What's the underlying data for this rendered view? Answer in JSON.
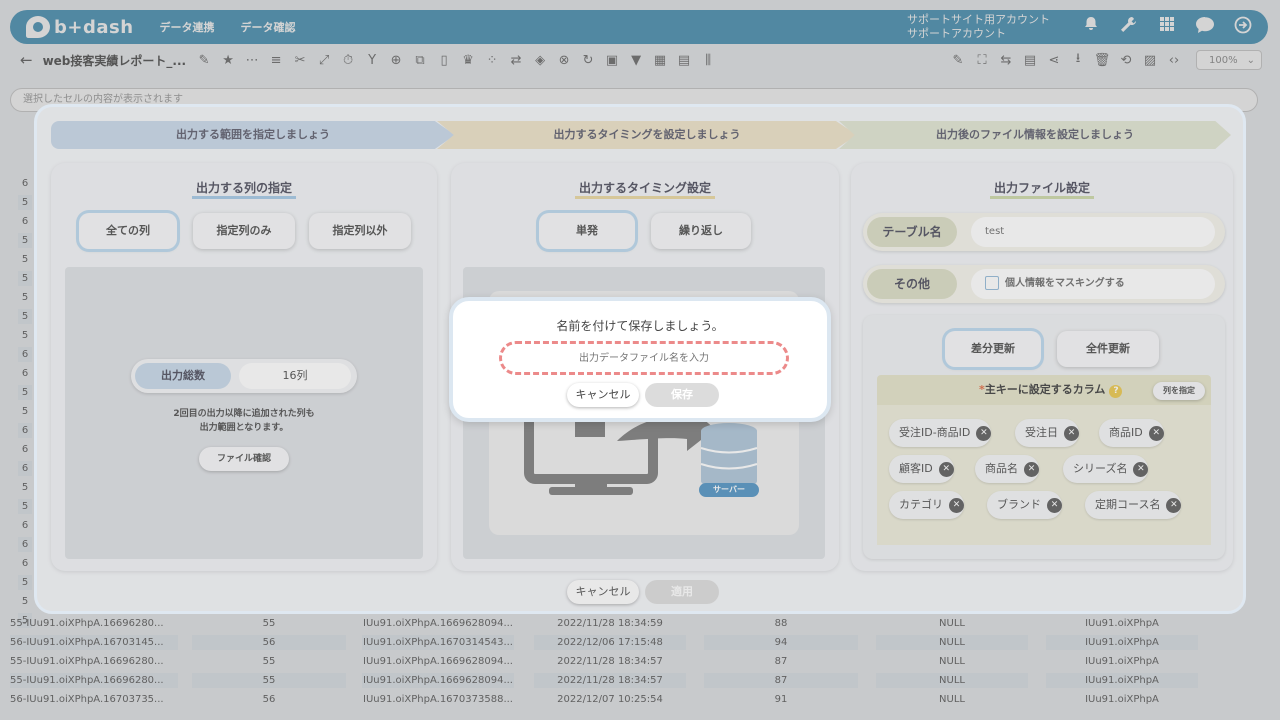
{
  "header": {
    "logo_text": "b+dash",
    "nav": [
      "データ連携",
      "データ確認"
    ],
    "account_line1": "サポートサイト用アカウント",
    "account_line2": "サポートアカウント"
  },
  "toolbar": {
    "back_icon": "arrow-left-icon",
    "report_title": "web接客実績レポート_...",
    "zoom": "100%"
  },
  "cell_bar": {
    "placeholder": "選択したセルの内容が表示されます"
  },
  "bg_table": {
    "top_rows": [
      "6",
      "5",
      "6",
      "5",
      "5",
      "5",
      "5",
      "5",
      "5",
      "6",
      "6",
      "5",
      "5",
      "6",
      "6",
      "6",
      "5",
      "5",
      "6",
      "6",
      "6",
      "5",
      "5",
      "5"
    ],
    "rows": [
      [
        "55-IUu91.oiXPhpA.16696280...",
        "55",
        "IUu91.oiXPhpA.1669628094...",
        "2022/11/28 18:34:59",
        "88",
        "NULL",
        "IUu91.oiXPhpA"
      ],
      [
        "56-IUu91.oiXPhpA.16703145...",
        "56",
        "IUu91.oiXPhpA.1670314543...",
        "2022/12/06 17:15:48",
        "94",
        "NULL",
        "IUu91.oiXPhpA"
      ],
      [
        "55-IUu91.oiXPhpA.16696280...",
        "55",
        "IUu91.oiXPhpA.1669628094...",
        "2022/11/28 18:34:57",
        "87",
        "NULL",
        "IUu91.oiXPhpA"
      ],
      [
        "55-IUu91.oiXPhpA.16696280...",
        "55",
        "IUu91.oiXPhpA.1669628094...",
        "2022/11/28 18:34:57",
        "87",
        "NULL",
        "IUu91.oiXPhpA"
      ],
      [
        "56-IUu91.oiXPhpA.16703735...",
        "56",
        "IUu91.oiXPhpA.1670373588...",
        "2022/12/07 10:25:54",
        "91",
        "NULL",
        "IUu91.oiXPhpA"
      ]
    ]
  },
  "steps": [
    "出力する範囲を指定しましょう",
    "出力するタイミングを設定しましょう",
    "出力後のファイル情報を設定しましょう"
  ],
  "columns_panel": {
    "title": "出力する列の指定",
    "options": [
      "全ての列",
      "指定列のみ",
      "指定列以外"
    ],
    "total_label": "出力総数",
    "total_value": "16列",
    "note_line1": "2回目の出力以降に追加された列も",
    "note_line2": "出力範囲となります。",
    "file_check_button": "ファイル確認"
  },
  "timing_panel": {
    "title": "出力するタイミング設定",
    "options": [
      "単発",
      "繰り返し"
    ],
    "server_label": "サーバー"
  },
  "file_panel": {
    "title": "出力ファイル設定",
    "table_name_label": "テーブル名",
    "table_name_value": "test",
    "other_label": "その他",
    "masking_label": "個人情報をマスキングする",
    "update_options": [
      "差分更新",
      "全件更新"
    ],
    "pk_title_mark": "*",
    "pk_title": "主キーに設定するカラム",
    "pk_info_icon": "info-icon",
    "specify_columns_button": "列を指定",
    "pk_columns": [
      "受注ID-商品ID",
      "受注日",
      "商品ID",
      "顧客ID",
      "商品名",
      "シリーズ名",
      "カテゴリ",
      "ブランド",
      "定期コース名"
    ]
  },
  "modal_footer": {
    "cancel": "キャンセル",
    "apply": "適用"
  },
  "save_dialog": {
    "message": "名前を付けて保存しましょう。",
    "input_placeholder": "出力データファイル名を入力",
    "input_value": "",
    "cancel": "キャンセル",
    "save": "保存"
  },
  "colors": {
    "header_blue": "#3f8fb5",
    "step1": "#c6d7e8",
    "step2": "#ece1c5",
    "step3": "#dfe4d0",
    "dashed_input_border": "#ec8a8a",
    "info_icon": "#e9c443"
  }
}
